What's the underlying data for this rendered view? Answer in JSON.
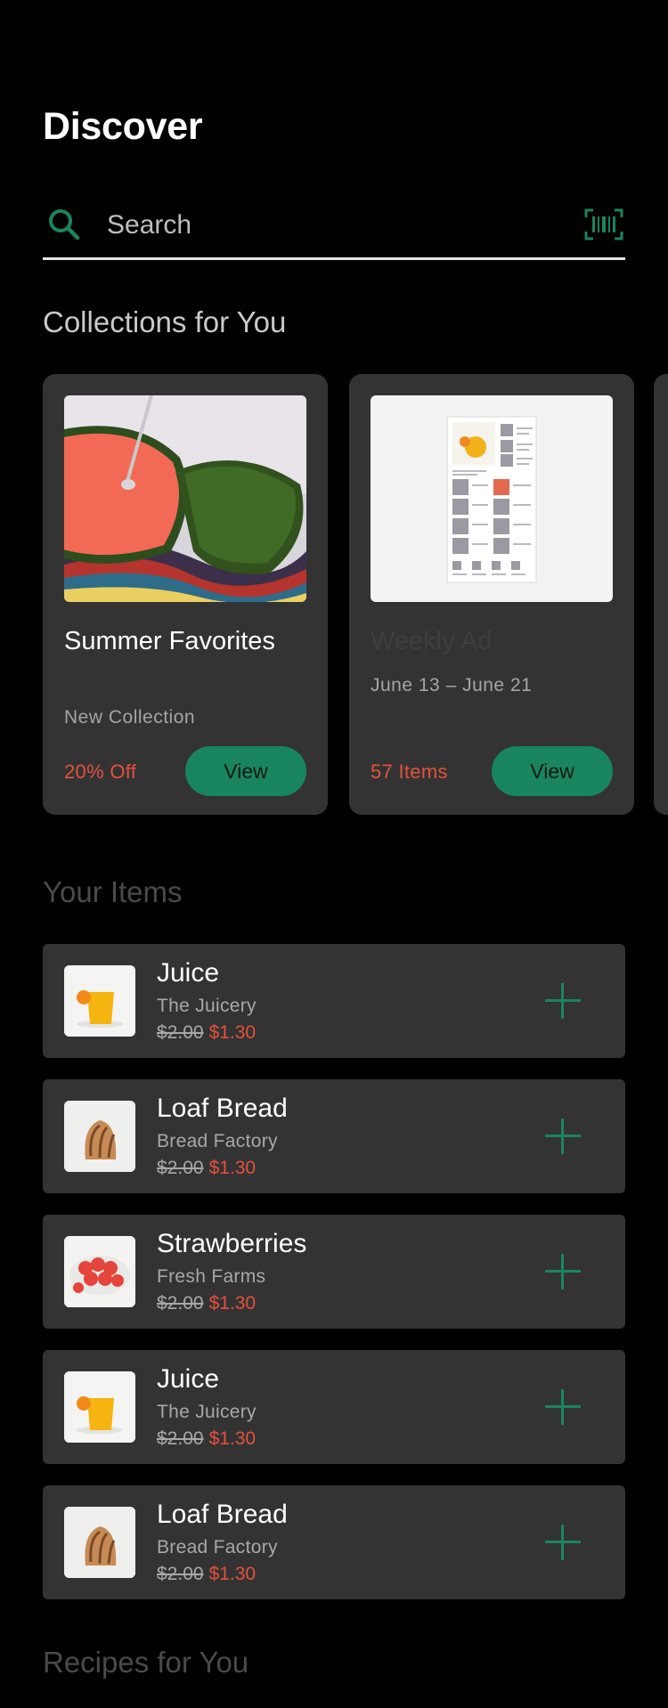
{
  "page": {
    "title": "Discover"
  },
  "search": {
    "placeholder": "Search"
  },
  "sections": {
    "collections": "Collections for You",
    "items": "Your Items",
    "recipes": "Recipes for You"
  },
  "collections": [
    {
      "name": "Summer Favorites",
      "subtitle": "New Collection",
      "tag": "20% Off",
      "button": "View"
    },
    {
      "name": "Weekly Ad",
      "subtitle": "June 13 – June 21",
      "tag": "57 Items",
      "button": "View"
    }
  ],
  "items": [
    {
      "name": "Juice",
      "vendor": "The Juicery",
      "old_price": "$2.00",
      "new_price": "$1.30",
      "image": "juice"
    },
    {
      "name": "Loaf Bread",
      "vendor": "Bread Factory",
      "old_price": "$2.00",
      "new_price": "$1.30",
      "image": "bread"
    },
    {
      "name": "Strawberries",
      "vendor": "Fresh Farms",
      "old_price": "$2.00",
      "new_price": "$1.30",
      "image": "strawberries"
    },
    {
      "name": "Juice",
      "vendor": "The Juicery",
      "old_price": "$2.00",
      "new_price": "$1.30",
      "image": "juice"
    },
    {
      "name": "Loaf Bread",
      "vendor": "Bread Factory",
      "old_price": "$2.00",
      "new_price": "$1.30",
      "image": "bread"
    }
  ],
  "colors": {
    "accent": "#19855f",
    "sale": "#e5513e",
    "card": "#333333",
    "background": "#000000"
  },
  "icons": {
    "search": "search-icon",
    "scan": "barcode-scan-icon",
    "add": "plus-icon"
  }
}
